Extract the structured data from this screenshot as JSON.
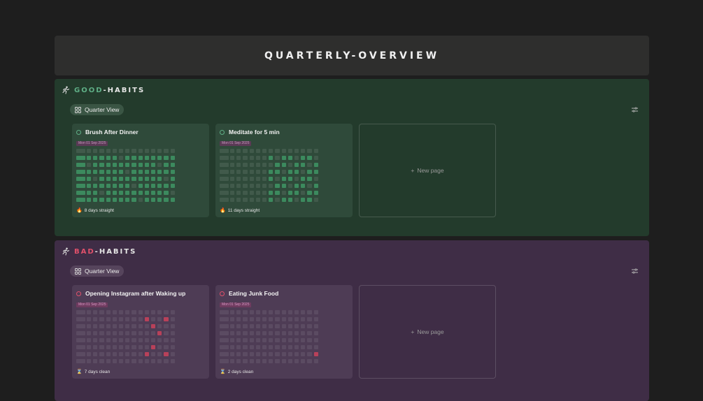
{
  "page_title": "QUARTERLY-OVERVIEW",
  "colors": {
    "good_accent": "#5fae86",
    "bad_accent": "#e0506a",
    "good_on": "#3c8a5e",
    "bad_on": "#b8415a"
  },
  "sections": {
    "good": {
      "title_colored": "GOOD",
      "title_rest": "-HABITS",
      "view_label": "Quarter View",
      "new_page": "New page",
      "cards": [
        {
          "title": "Brush After Dinner",
          "date": "Mon 01 Sep 2025",
          "streak": "8 days straight",
          "streak_icon": "fire-icon",
          "pattern": "full"
        },
        {
          "title": "Meditate for 5 min",
          "date": "Mon 01 Sep 2025",
          "streak": "11 days straight",
          "streak_icon": "fire-icon",
          "pattern": "partial"
        }
      ]
    },
    "bad": {
      "title_colored": "BAD",
      "title_rest": "-HABITS",
      "view_label": "Quarter View",
      "new_page": "New page",
      "cards": [
        {
          "title": "Opening Instagram after Waking up",
          "date": "Mon 01 Sep 2025",
          "streak": "7 days clean",
          "streak_icon": "hourglass-icon",
          "pattern": "bad1"
        },
        {
          "title": "Eating Junk Food",
          "date": "Mon 01 Sep 2025",
          "streak": "2 days clean",
          "streak_icon": "hourglass-icon",
          "pattern": "bad2"
        }
      ]
    }
  }
}
